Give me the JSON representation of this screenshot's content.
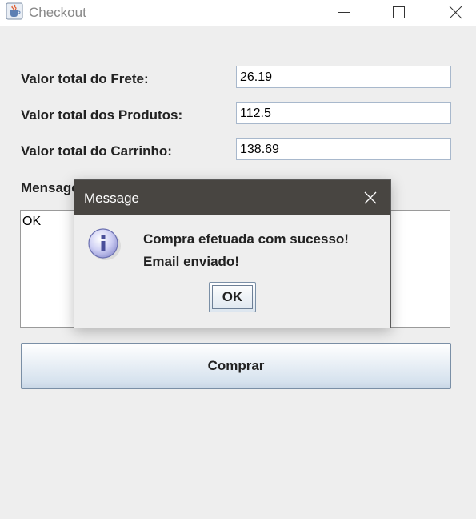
{
  "window": {
    "title": "Checkout",
    "icon": "java-coffee-cup-icon",
    "controls": [
      "minimize-icon",
      "maximize-icon",
      "close-icon"
    ]
  },
  "form": {
    "freight_label": "Valor total do Frete:",
    "freight_value": "26.19",
    "products_label": "Valor total dos Produtos:",
    "products_value": "112.5",
    "cart_label": "Valor total do Carrinho:",
    "cart_value": "138.69",
    "message_label": "Mensagem:",
    "message_text": "OK"
  },
  "buy_button": {
    "label": "Comprar"
  },
  "dialog": {
    "title": "Message",
    "icon": "info-icon",
    "line1": "Compra efetuada com sucesso!",
    "line2": "Email enviado!",
    "ok_label": "OK"
  }
}
